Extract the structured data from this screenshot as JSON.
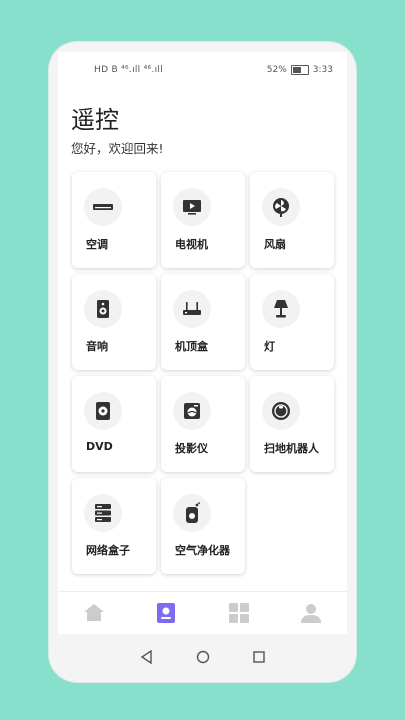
{
  "status": {
    "left_text": "HD B ⁴⁶.ıll ⁴⁶.ıll",
    "battery_percent": "52%",
    "time": "3:33"
  },
  "header": {
    "title": "遥控",
    "greeting": "您好，欢迎回来!"
  },
  "devices": [
    {
      "label": "空调",
      "icon": "air-conditioner-icon"
    },
    {
      "label": "电视机",
      "icon": "tv-icon"
    },
    {
      "label": "风扇",
      "icon": "fan-icon"
    },
    {
      "label": "音响",
      "icon": "speaker-icon"
    },
    {
      "label": "机顶盒",
      "icon": "set-top-box-icon"
    },
    {
      "label": "灯",
      "icon": "lamp-icon"
    },
    {
      "label": "DVD",
      "icon": "dvd-icon"
    },
    {
      "label": "投影仪",
      "icon": "projector-icon"
    },
    {
      "label": "扫地机器人",
      "icon": "robot-vacuum-icon"
    },
    {
      "label": "网络盒子",
      "icon": "network-box-icon"
    },
    {
      "label": "空气净化器",
      "icon": "air-purifier-icon"
    }
  ],
  "tabs": [
    {
      "icon": "home-icon",
      "active": false
    },
    {
      "icon": "remote-icon",
      "active": true
    },
    {
      "icon": "grid-icon",
      "active": false
    },
    {
      "icon": "user-icon",
      "active": false
    }
  ],
  "colors": {
    "background": "#86e0cb",
    "accent": "#7b6cf0",
    "icon": "#333333",
    "inactive_tab": "#cccccc"
  }
}
